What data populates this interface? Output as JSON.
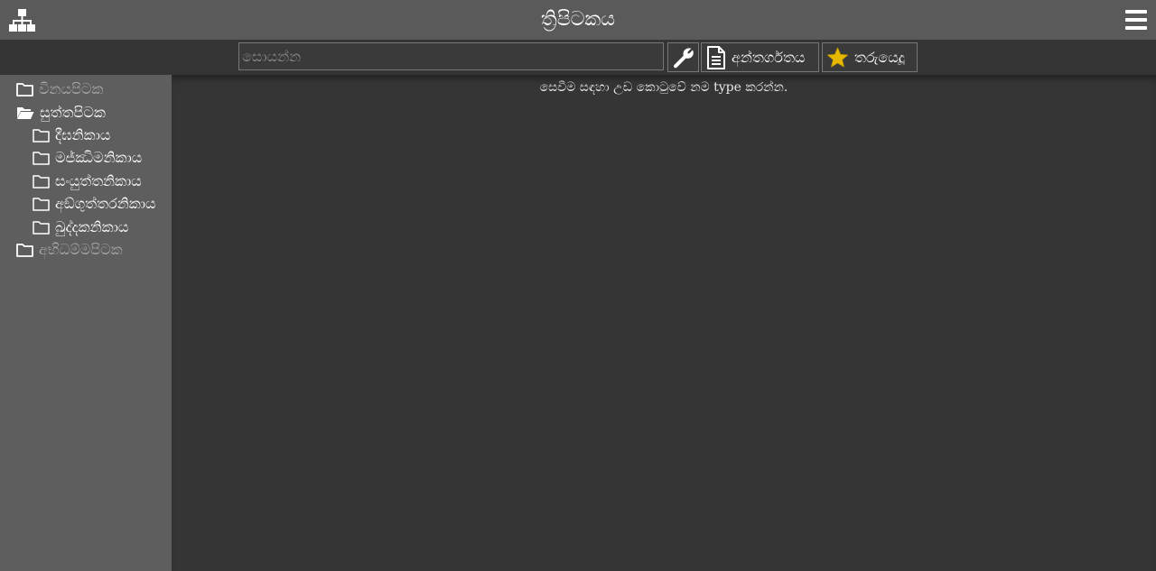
{
  "app": {
    "title": "ත්‍රිපිටකය",
    "tree_icon": "sitemap-icon",
    "menu_icon": "hamburger-menu-icon"
  },
  "toolbar": {
    "search_placeholder": "සොයන්න",
    "wrench_icon": "wrench-icon",
    "contents_icon": "document-icon",
    "contents_label": "අන්තර්ගතය",
    "stars_icon": "star-icon",
    "stars_label": "තරුයෙදූ",
    "star_color": "#e6b800"
  },
  "sidebar": {
    "items": [
      {
        "label": "විනයපිටක",
        "icon": "folder-closed-icon",
        "state": "dim"
      },
      {
        "label": "සුත්තපිටක",
        "icon": "folder-open-icon",
        "state": "expanded"
      },
      {
        "label": "දීඝනිකාය",
        "icon": "folder-closed-icon",
        "state": "child"
      },
      {
        "label": "මජ්ඣිමනිකාය",
        "icon": "folder-closed-icon",
        "state": "child"
      },
      {
        "label": "සංයුත්තනිකාය",
        "icon": "folder-closed-icon",
        "state": "child"
      },
      {
        "label": "අඞ්ගුත්තරනිකාය",
        "icon": "folder-closed-icon",
        "state": "child"
      },
      {
        "label": "ඛුද්දකනිකාය",
        "icon": "folder-closed-icon",
        "state": "child"
      },
      {
        "label": "අභිධම්මපිටක",
        "icon": "folder-closed-icon",
        "state": "dim"
      }
    ]
  },
  "main": {
    "hint": "සෙවීම සඳහා උඩ කොටුවේ නම type කරන්න."
  }
}
